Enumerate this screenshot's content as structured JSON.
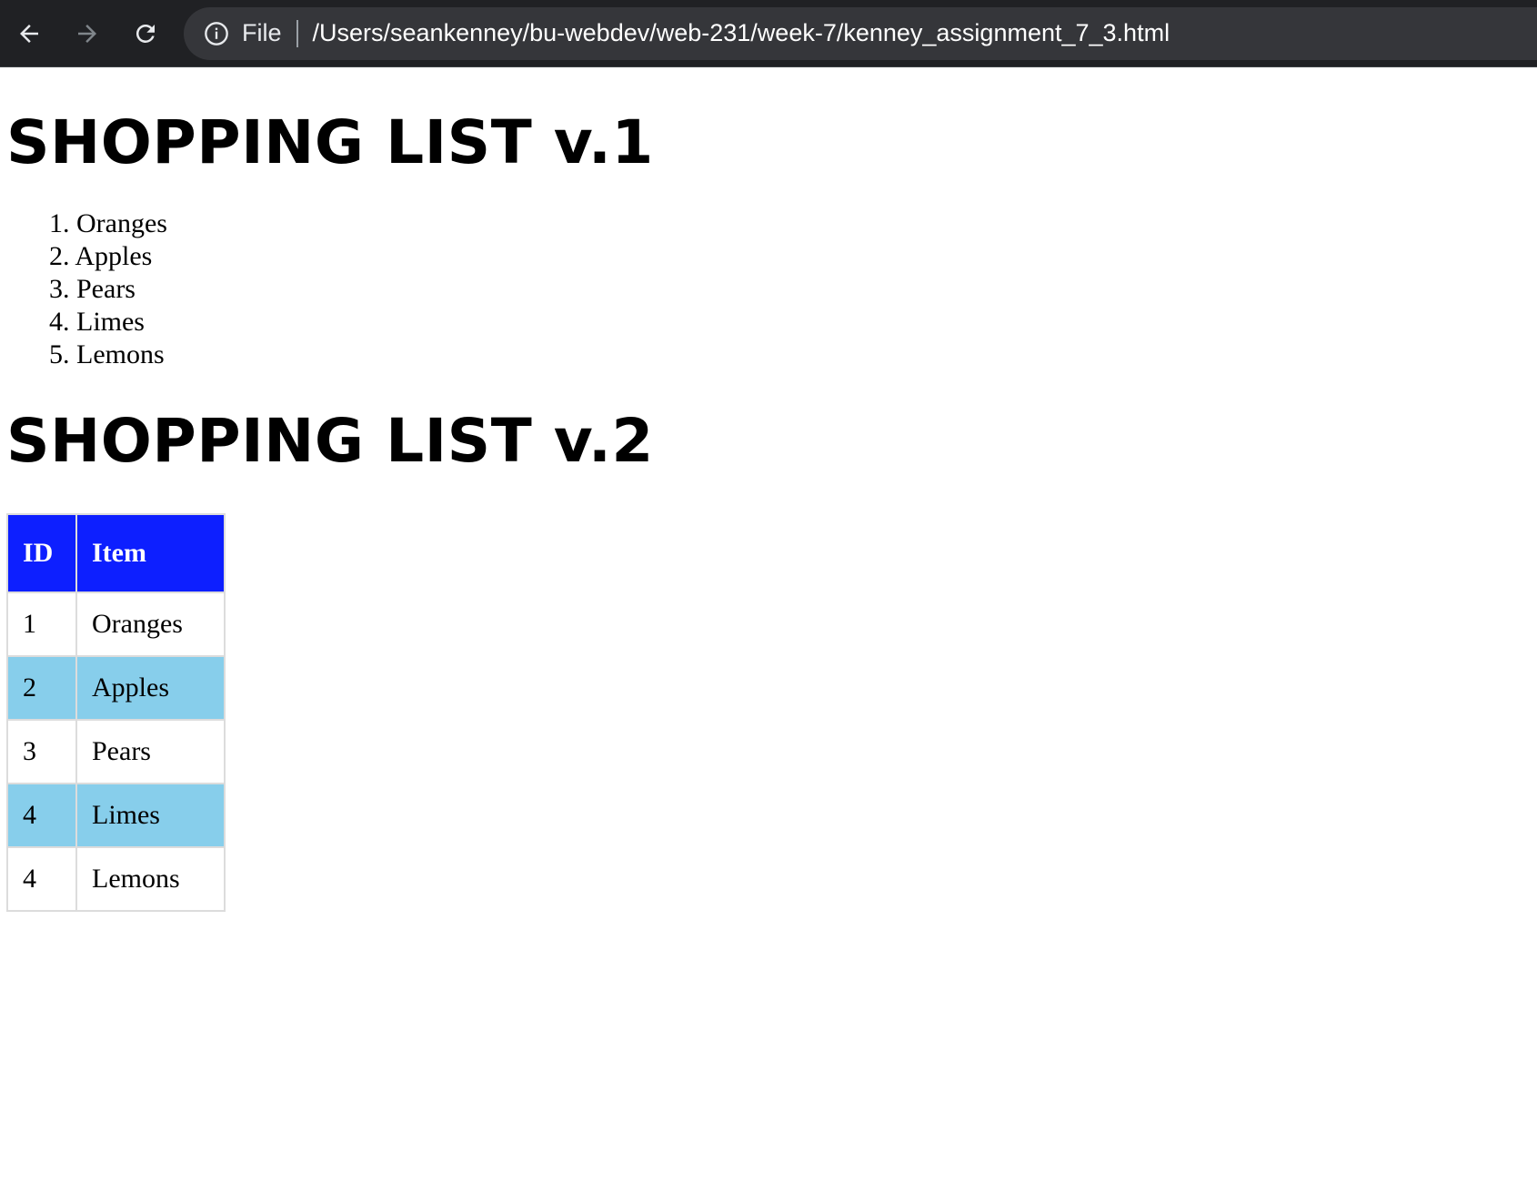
{
  "browser": {
    "chip_label": "File",
    "url": "/Users/seankenney/bu-webdev/web-231/week-7/kenney_assignment_7_3.html"
  },
  "section1": {
    "heading": "SHOPPING LIST v.1",
    "items": [
      "Oranges",
      "Apples",
      "Pears",
      "Limes",
      "Lemons"
    ]
  },
  "section2": {
    "heading": "SHOPPING LIST v.2",
    "table": {
      "header_bg": "#0d1fff",
      "stripe_bg": "#87ceeb",
      "headers": [
        "ID",
        "Item"
      ],
      "rows": [
        [
          "1",
          "Oranges"
        ],
        [
          "2",
          "Apples"
        ],
        [
          "3",
          "Pears"
        ],
        [
          "4",
          "Limes"
        ],
        [
          "4",
          "Lemons"
        ]
      ]
    }
  }
}
